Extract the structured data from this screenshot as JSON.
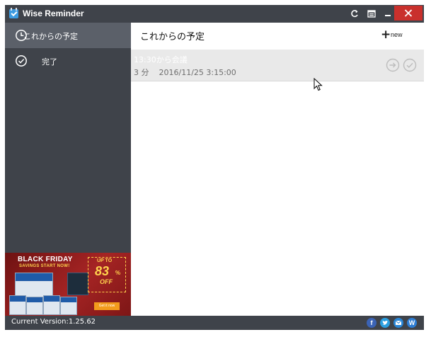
{
  "titlebar": {
    "app_name": "Wise Reminder"
  },
  "sidebar": {
    "items": [
      {
        "label": "これからの予定",
        "icon": "clock-icon",
        "active": true
      },
      {
        "label": "完了",
        "icon": "check-circle-icon",
        "active": false
      }
    ],
    "ad": {
      "line1": "BLACK FRIDAY",
      "line2": "SAVINGS START NOW!",
      "upto": "UP TO",
      "percent": "83",
      "percent_sign": "%",
      "off": "OFF",
      "button": "Get it now"
    }
  },
  "main": {
    "title": "これからの予定",
    "new_label": "new",
    "reminders": [
      {
        "title": "13:30から会議",
        "remaining": "3 分",
        "datetime": "2016/11/25 3:15:00"
      }
    ]
  },
  "footer": {
    "version": "Current Version:1.25.62"
  },
  "colors": {
    "chrome": "#3f434a",
    "active_item": "#5b6069",
    "close": "#c9302c",
    "row_bg": "#e9e9e9"
  }
}
